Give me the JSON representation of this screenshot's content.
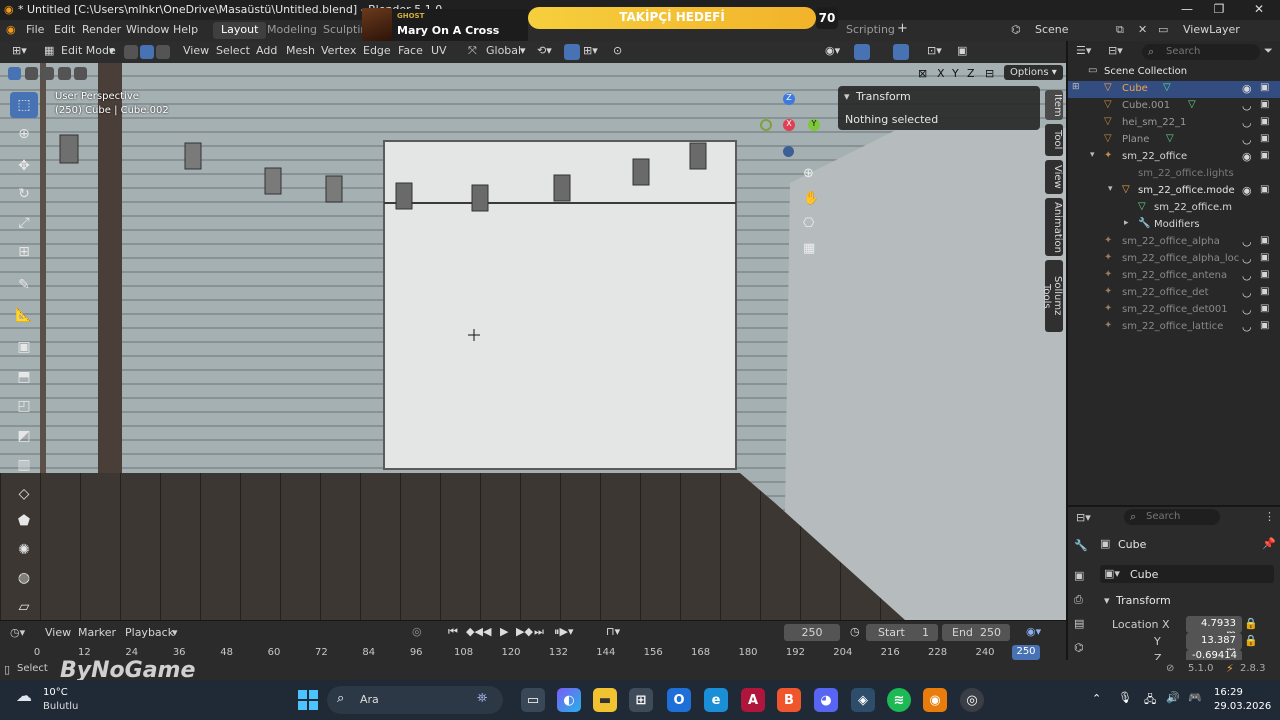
{
  "window": {
    "title": "* Untitled [C:\\Users\\mlhkr\\OneDrive\\Masaüstü\\Untitled.blend] - Blender 5.1.0",
    "minimize": "—",
    "maximize": "❐",
    "close": "✕"
  },
  "menubar": {
    "items": [
      "File",
      "Edit",
      "Render",
      "Window",
      "Help"
    ],
    "workspaces": [
      "Layout",
      "Modeling",
      "Sculptin",
      "Scripting"
    ],
    "active_workspace": "Layout",
    "add_workspace": "+",
    "scene_label": "Scene",
    "viewlayer_label": "ViewLayer"
  },
  "overlay": {
    "ghost_label": "GHOST",
    "song": "Mary On A Cross",
    "banner_text": "TAKİPÇİ HEDEFİ",
    "count": "70"
  },
  "viewport_header": {
    "mode": "Edit Mode",
    "menus": [
      "View",
      "Select",
      "Add",
      "Mesh",
      "Vertex",
      "Edge",
      "Face",
      "UV"
    ],
    "orientation": "Global",
    "axes": [
      "X",
      "Y",
      "Z"
    ],
    "options_label": "Options"
  },
  "viewport": {
    "perspective": "User Perspective",
    "object_info": "(250) Cube | Cube.002",
    "wall_color": "#9aa6a8",
    "door_color": "#e4e6e6",
    "floor_color": "#3a3632"
  },
  "npanel": {
    "section": "Transform",
    "message": "Nothing selected",
    "tabs": [
      "Item",
      "Tool",
      "View",
      "Animation",
      "Sollumz Tools"
    ]
  },
  "outliner": {
    "search_placeholder": "Search",
    "root": "Scene Collection",
    "items": [
      {
        "name": "Cube",
        "selected": true
      },
      {
        "name": "Cube.001",
        "selected": false
      },
      {
        "name": "hei_sm_22_1",
        "selected": false
      },
      {
        "name": "Plane",
        "selected": false
      },
      {
        "name": "sm_22_office",
        "selected": false
      },
      {
        "name": "sm_22_office.lights",
        "selected": false
      },
      {
        "name": "sm_22_office.mode",
        "selected": false
      },
      {
        "name": "sm_22_office.m",
        "selected": false
      },
      {
        "name": "Modifiers",
        "selected": false
      },
      {
        "name": "sm_22_office_alpha",
        "selected": false
      },
      {
        "name": "sm_22_office_alpha_loc",
        "selected": false
      },
      {
        "name": "sm_22_office_antena",
        "selected": false
      },
      {
        "name": "sm_22_office_det",
        "selected": false
      },
      {
        "name": "sm_22_office_det001",
        "selected": false
      },
      {
        "name": "sm_22_office_lattice",
        "selected": false
      }
    ]
  },
  "properties": {
    "search_placeholder": "Search",
    "context": "Cube",
    "object_name": "Cube",
    "section": "Transform",
    "location_x_label": "Location X",
    "location_x": "4.7933 m",
    "y_label": "Y",
    "location_y": "13.387 m",
    "z_label": "Z",
    "location_z": "-0.69414"
  },
  "timeline": {
    "menus": [
      "View",
      "Marker",
      "Playback"
    ],
    "current_frame": "250",
    "start_label": "Start",
    "start": "1",
    "end_label": "End",
    "end": "250",
    "ticks": [
      "0",
      "12",
      "24",
      "36",
      "48",
      "60",
      "72",
      "84",
      "96",
      "108",
      "120",
      "132",
      "144",
      "156",
      "168",
      "180",
      "192",
      "204",
      "216",
      "228",
      "240"
    ],
    "playhead": "250"
  },
  "statusbar": {
    "select": "Select",
    "watermark": "ByNoGame",
    "version": "5.1.0",
    "fps": "2.8.3"
  },
  "taskbar": {
    "weather_temp": "10°C",
    "weather_desc": "Bulutlu",
    "search": "Ara",
    "time": "16:29",
    "date": "29.03.2026"
  }
}
